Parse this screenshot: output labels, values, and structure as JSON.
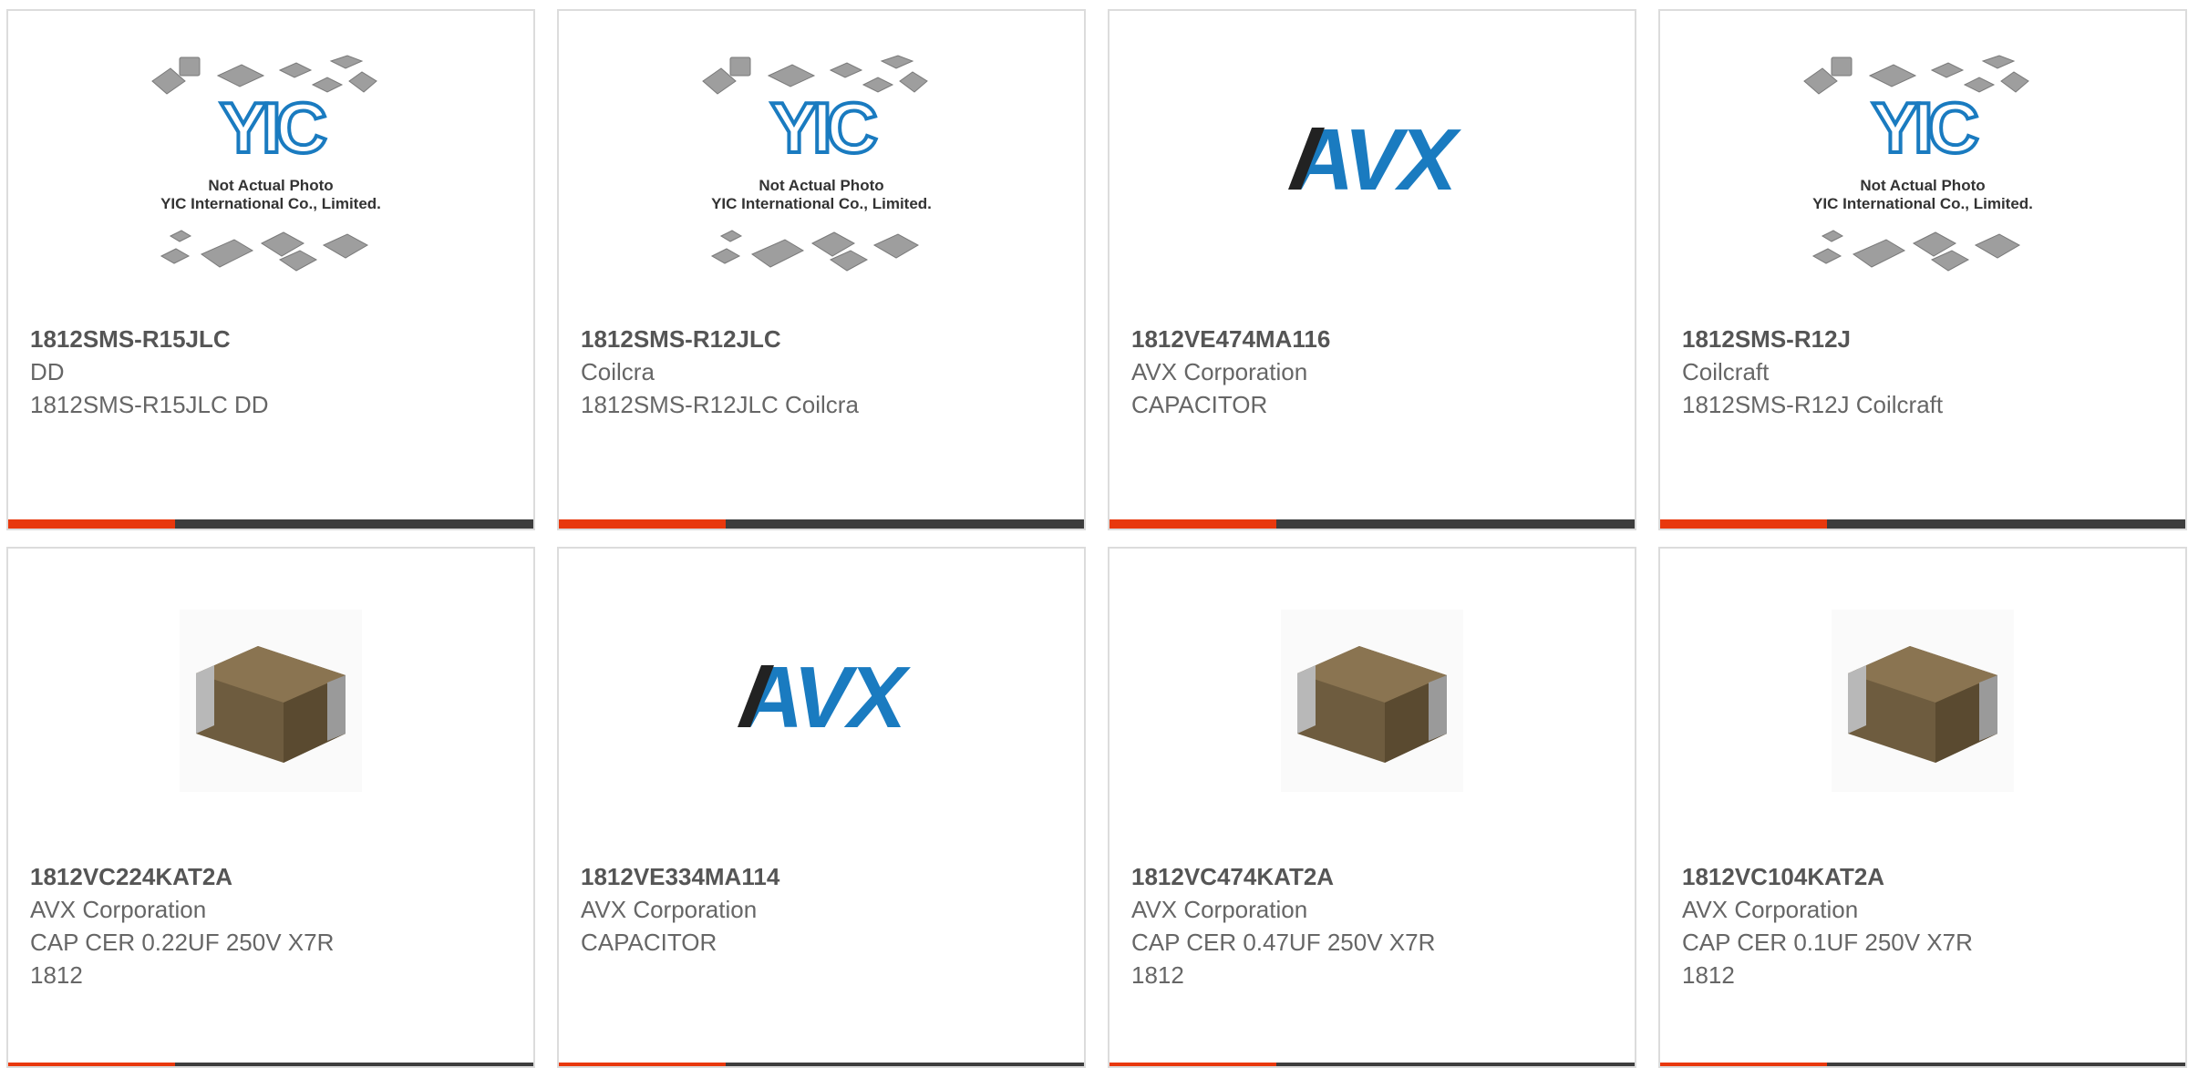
{
  "colors": {
    "accent": "#e8380d",
    "bar": "#3d3d3d",
    "border": "#dcdcdc",
    "avx_blue": "#1a7bc0"
  },
  "products": [
    {
      "part_number": "1812SMS-R15JLC",
      "manufacturer": "DD",
      "description": "1812SMS-R15JLC DD",
      "image": {
        "type": "placeholder",
        "logo": "YIC",
        "line1": "Not Actual Photo",
        "line2": "YIC International Co., Limited."
      }
    },
    {
      "part_number": "1812SMS-R12JLC",
      "manufacturer": "Coilcra",
      "description": "1812SMS-R12JLC Coilcra",
      "image": {
        "type": "placeholder",
        "logo": "YIC",
        "line1": "Not Actual Photo",
        "line2": "YIC International Co., Limited."
      }
    },
    {
      "part_number": "1812VE474MA116",
      "manufacturer": "AVX Corporation",
      "description": "CAPACITOR",
      "image": {
        "type": "avx-logo",
        "logo": "AVX"
      }
    },
    {
      "part_number": "1812SMS-R12J",
      "manufacturer": "Coilcraft",
      "description": "1812SMS-R12J Coilcraft",
      "image": {
        "type": "placeholder",
        "logo": "YIC",
        "line1": "Not Actual Photo",
        "line2": "YIC International Co., Limited."
      }
    },
    {
      "part_number": "1812VC224KAT2A",
      "manufacturer": "AVX Corporation",
      "description": "CAP CER 0.22UF 250V X7R 1812",
      "image": {
        "type": "capacitor-chip"
      }
    },
    {
      "part_number": "1812VE334MA114",
      "manufacturer": "AVX Corporation",
      "description": "CAPACITOR",
      "image": {
        "type": "avx-logo",
        "logo": "AVX"
      }
    },
    {
      "part_number": "1812VC474KAT2A",
      "manufacturer": "AVX Corporation",
      "description": "CAP CER 0.47UF 250V X7R 1812",
      "image": {
        "type": "capacitor-chip"
      }
    },
    {
      "part_number": "1812VC104KAT2A",
      "manufacturer": "AVX Corporation",
      "description": "CAP CER 0.1UF 250V X7R 1812",
      "image": {
        "type": "capacitor-chip"
      }
    }
  ]
}
